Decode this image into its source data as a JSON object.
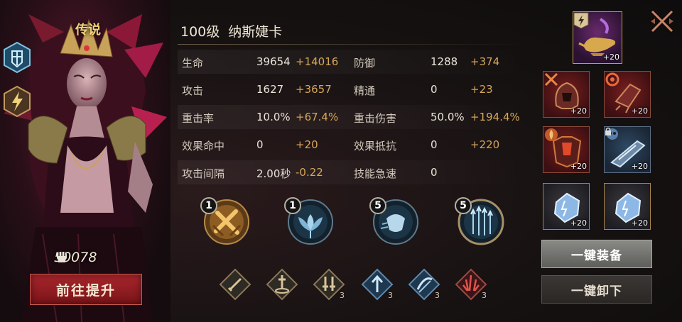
{
  "hero": {
    "rarity": "传说",
    "level": "100级",
    "name": "纳斯婕卡",
    "power": "50078"
  },
  "buttons": {
    "upgrade": "前往提升",
    "equip_all": "一键装备",
    "unequip_all": "一键卸下"
  },
  "stats": [
    {
      "label": "生命",
      "value": "39654",
      "bonus": "+14016",
      "label2": "防御",
      "value2": "1288",
      "bonus2": "+374"
    },
    {
      "label": "攻击",
      "value": "1627",
      "bonus": "+3657",
      "label2": "精通",
      "value2": "0",
      "bonus2": "+23"
    },
    {
      "label": "重击率",
      "value": "10.0%",
      "bonus": "+67.4%",
      "label2": "重击伤害",
      "value2": "50.0%",
      "bonus2": "+194.4%"
    },
    {
      "label": "效果命中",
      "value": "0",
      "bonus": "+20",
      "label2": "效果抵抗",
      "value2": "0",
      "bonus2": "+220"
    },
    {
      "label": "攻击间隔",
      "value": "2.00秒",
      "bonus": "-0.22",
      "label2": "技能急速",
      "value2": "0",
      "bonus2": ""
    }
  ],
  "skills": [
    {
      "icon": "crossed-swords-icon",
      "level": "1"
    },
    {
      "icon": "lotus-flower-icon",
      "level": "1"
    },
    {
      "icon": "shield-bash-icon",
      "level": "5"
    },
    {
      "icon": "arrow-volley-icon",
      "level": "5"
    }
  ],
  "runes": [
    {
      "icon": "sword-rune-icon",
      "count": ""
    },
    {
      "icon": "planted-sword-rune-icon",
      "count": ""
    },
    {
      "icon": "twin-swords-rune-icon",
      "count": "3"
    },
    {
      "icon": "arrow-up-rune-icon",
      "count": "3"
    },
    {
      "icon": "slash-rune-icon",
      "count": "3"
    },
    {
      "icon": "blood-spike-rune-icon",
      "count": "3"
    }
  ],
  "equipment": {
    "artifact": {
      "icon": "magic-lamp-icon",
      "level": "+20"
    },
    "slots": [
      {
        "icon": "helmet-icon",
        "level": "+20"
      },
      {
        "icon": "gauntlet-icon",
        "level": "+20"
      },
      {
        "icon": "chest-armor-icon",
        "level": "+20"
      },
      {
        "icon": "blade-weapon-icon",
        "level": "+20"
      },
      {
        "icon": "crystal-gem-icon",
        "level": "+20"
      },
      {
        "icon": "crystal-gem-icon",
        "level": "+20"
      }
    ]
  },
  "colors": {
    "bonus": "#d6a65a",
    "upgrade_button": "#a8262d",
    "rarity_gold": "#f0d27a"
  }
}
